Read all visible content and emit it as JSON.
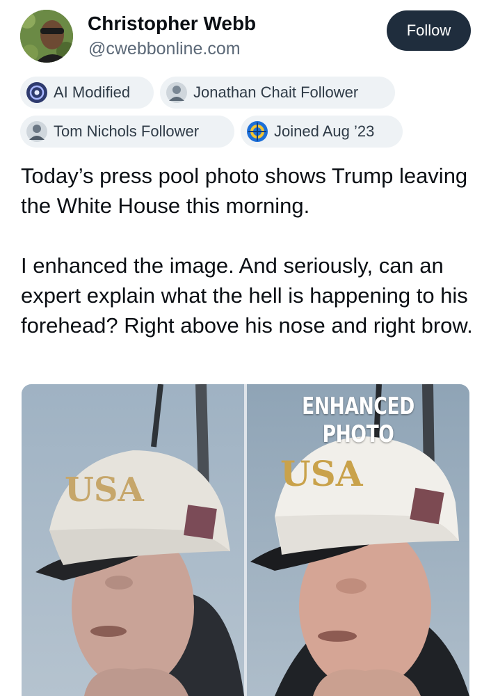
{
  "profile": {
    "name": "Christopher Webb",
    "handle": "@cwebbonline.com",
    "follow_label": "Follow",
    "avatar_icon": "user-avatar"
  },
  "badges": [
    {
      "label": "AI Modified",
      "icon": "ai-icon",
      "color": "#3a4a8a"
    },
    {
      "label": "Jonathan Chait Follower",
      "icon": "person-avatar-icon",
      "color": "#7a8794"
    },
    {
      "label": "Tom Nichols Follower",
      "icon": "person-avatar-icon",
      "color": "#7a8794"
    },
    {
      "label": "Joined Aug ’23",
      "icon": "globe-badge-icon",
      "color": "#1d6fd8"
    }
  ],
  "post": {
    "paragraphs": [
      "Today’s press pool photo shows Trump leaving the White House this morning.",
      "I enhanced the image. And  seriously, can an expert explain what the hell is happening to his forehead? Right above his nose and right brow."
    ]
  },
  "media": {
    "right_label": "ENHANCED PHOTO",
    "cap_text": "USA"
  },
  "colors": {
    "follow_bg": "#1f2d3d",
    "badge_bg": "#eef2f5",
    "handle": "#5b6877",
    "text": "#0b0f14"
  }
}
